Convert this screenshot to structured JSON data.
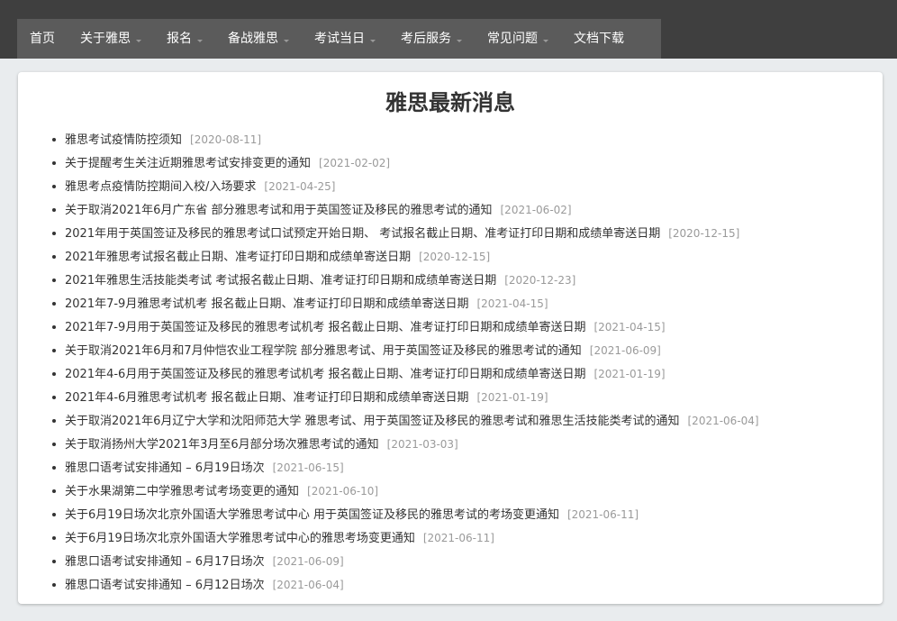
{
  "nav": {
    "items": [
      {
        "label": "首页",
        "dropdown": false
      },
      {
        "label": "关于雅思",
        "dropdown": true
      },
      {
        "label": "报名",
        "dropdown": true
      },
      {
        "label": "备战雅思",
        "dropdown": true
      },
      {
        "label": "考试当日",
        "dropdown": true
      },
      {
        "label": "考后服务",
        "dropdown": true
      },
      {
        "label": "常见问题",
        "dropdown": true
      },
      {
        "label": "文档下载",
        "dropdown": false
      }
    ]
  },
  "main": {
    "title": "雅思最新消息",
    "news": [
      {
        "title": "雅思考试疫情防控须知",
        "date": "[2020-08-11]"
      },
      {
        "title": "关于提醒考生关注近期雅思考试安排变更的通知",
        "date": "[2021-02-02]"
      },
      {
        "title": "雅思考点疫情防控期间入校/入场要求",
        "date": "[2021-04-25]"
      },
      {
        "title": "关于取消2021年6月广东省 部分雅思考试和用于英国签证及移民的雅思考试的通知",
        "date": "[2021-06-02]"
      },
      {
        "title": "2021年用于英国签证及移民的雅思考试口试预定开始日期、 考试报名截止日期、准考证打印日期和成绩单寄送日期",
        "date": "[2020-12-15]"
      },
      {
        "title": "2021年雅思考试报名截止日期、准考证打印日期和成绩单寄送日期",
        "date": "[2020-12-15]"
      },
      {
        "title": "2021年雅思生活技能类考试 考试报名截止日期、准考证打印日期和成绩单寄送日期",
        "date": "[2020-12-23]"
      },
      {
        "title": "2021年7-9月雅思考试机考 报名截止日期、准考证打印日期和成绩单寄送日期",
        "date": "[2021-04-15]"
      },
      {
        "title": "2021年7-9月用于英国签证及移民的雅思考试机考 报名截止日期、准考证打印日期和成绩单寄送日期",
        "date": "[2021-04-15]"
      },
      {
        "title": "关于取消2021年6月和7月仲恺农业工程学院 部分雅思考试、用于英国签证及移民的雅思考试的通知",
        "date": "[2021-06-09]"
      },
      {
        "title": "2021年4-6月用于英国签证及移民的雅思考试机考 报名截止日期、准考证打印日期和成绩单寄送日期",
        "date": "[2021-01-19]"
      },
      {
        "title": "2021年4-6月雅思考试机考 报名截止日期、准考证打印日期和成绩单寄送日期",
        "date": "[2021-01-19]"
      },
      {
        "title": "关于取消2021年6月辽宁大学和沈阳师范大学 雅思考试、用于英国签证及移民的雅思考试和雅思生活技能类考试的通知",
        "date": "[2021-06-04]"
      },
      {
        "title": "关于取消扬州大学2021年3月至6月部分场次雅思考试的通知",
        "date": "[2021-03-03]"
      },
      {
        "title": "雅思口语考试安排通知 – 6月19日场次",
        "date": "[2021-06-15]"
      },
      {
        "title": "关于水果湖第二中学雅思考试考场变更的通知",
        "date": "[2021-06-10]"
      },
      {
        "title": "关于6月19日场次北京外国语大学雅思考试中心 用于英国签证及移民的雅思考试的考场变更通知",
        "date": "[2021-06-11]"
      },
      {
        "title": "关于6月19日场次北京外国语大学雅思考试中心的雅思考场变更通知",
        "date": "[2021-06-11]"
      },
      {
        "title": "雅思口语考试安排通知 – 6月17日场次",
        "date": "[2021-06-09]"
      },
      {
        "title": "雅思口语考试安排通知 – 6月12日场次",
        "date": "[2021-06-04]"
      }
    ]
  }
}
